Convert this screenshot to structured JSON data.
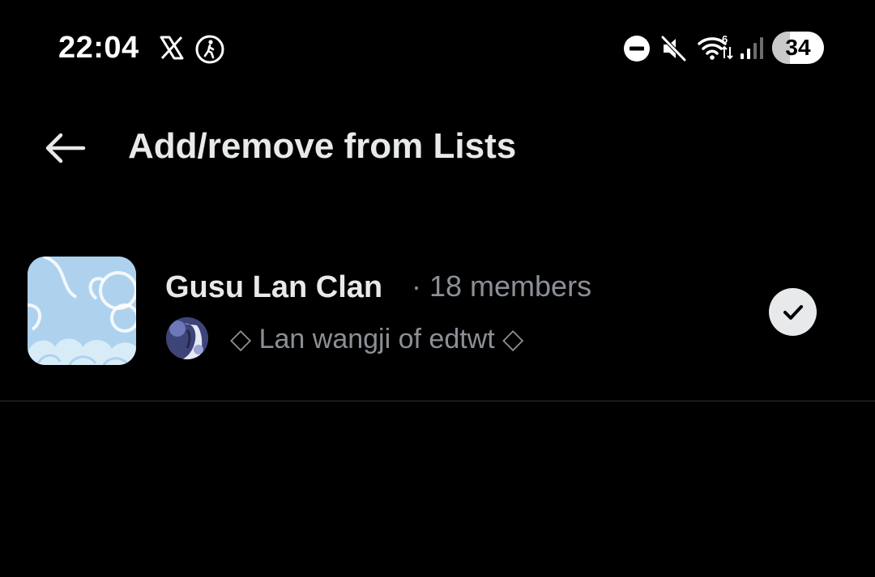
{
  "status_bar": {
    "time": "22:04",
    "battery_level": "34",
    "battery_fraction": 0.34,
    "icons": [
      "x-logo-icon",
      "accessibility-walk-icon",
      "do-not-disturb-icon",
      "mute-icon",
      "wifi-icon",
      "signal-icon",
      "battery-icon"
    ]
  },
  "header": {
    "title": "Add/remove from Lists",
    "back_icon": "arrow-left-icon"
  },
  "lists": [
    {
      "name": "Gusu Lan Clan",
      "meta": "· 18 members",
      "owner": "◇ Lan wangji of edtwt ◇",
      "selected": true
    }
  ],
  "colors": {
    "background": "#000000",
    "primary_text": "#e7e9ea",
    "secondary_text": "#8b9096",
    "divider": "#2a2d30",
    "thumbnail": "#aed2ee"
  }
}
